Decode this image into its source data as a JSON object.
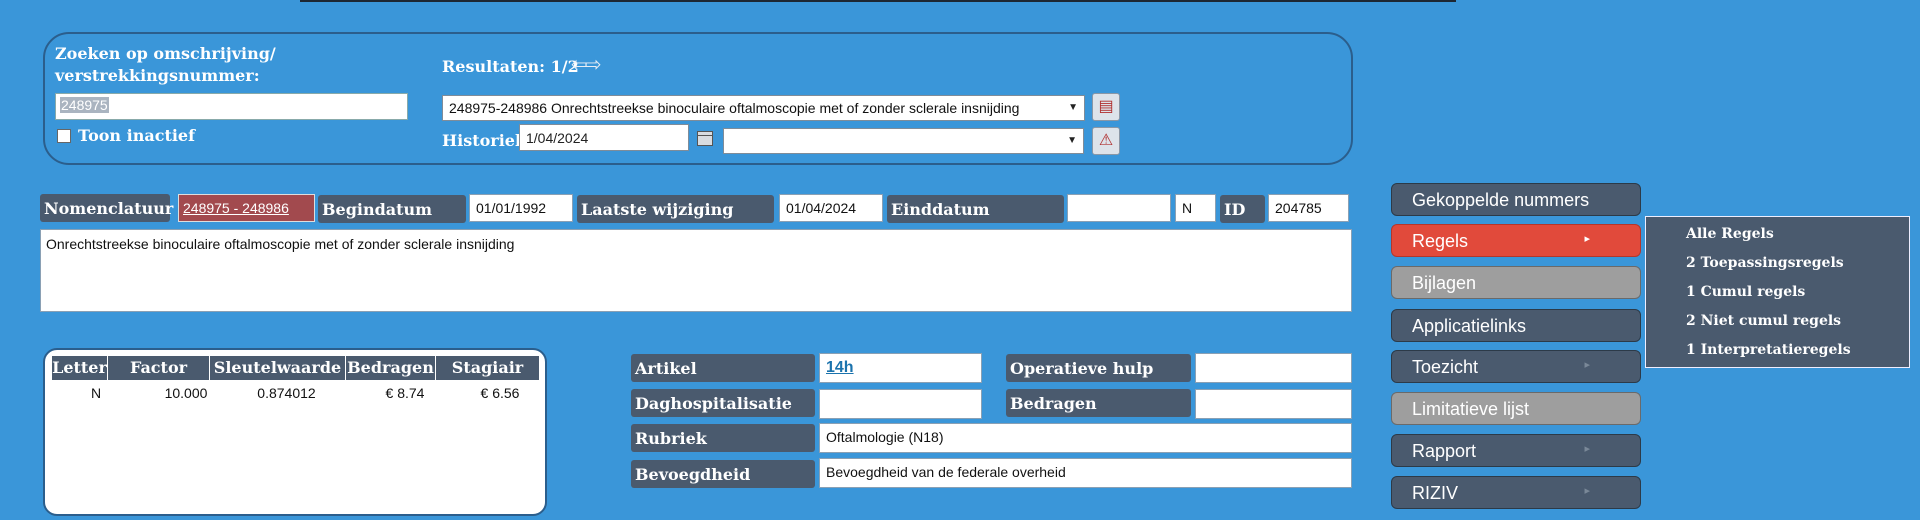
{
  "search": {
    "label": "Zoeken op omschrijving/ verstrekkingsnummer:",
    "value": "248975",
    "show_inactive_label": "Toon inactief",
    "results_label": "Resultaten: 1/2",
    "results_arrows": "⇦⇨",
    "selected_result": "248975-248986 Onrechtstreekse binoculaire oftalmoscopie met of zonder sclerale insnijding",
    "history_label": "Historiek",
    "history_date": "1/04/2024",
    "history_select": ""
  },
  "header": {
    "nomenclatuur_label": "Nomenclatuur",
    "nomenclatuur_value": "248975 - 248986",
    "begindatum_label": "Begindatum",
    "begindatum_value": "01/01/1992",
    "laatste_wijziging_label": "Laatste wijziging",
    "laatste_wijziging_value": "01/04/2024",
    "einddatum_label": "Einddatum",
    "einddatum_value": "",
    "flag_value": "N",
    "id_label": "ID",
    "id_value": "204785"
  },
  "description": "Onrechtstreekse binoculaire oftalmoscopie met of zonder sclerale insnijding",
  "table": {
    "columns": [
      "Letter",
      "Factor",
      "Sleutelwaarde",
      "Bedragen",
      "Stagiair"
    ],
    "rows": [
      [
        "N",
        "10.000",
        "0.874012",
        "€ 8.74",
        "€ 6.56"
      ]
    ]
  },
  "details": {
    "artikel_label": "Artikel",
    "artikel_value": "14h",
    "operatieve_hulp_label": "Operatieve hulp",
    "operatieve_hulp_value": "",
    "daghospitalisatie_label": "Daghospitalisatie",
    "daghospitalisatie_value": "",
    "bedragen_label": "Bedragen",
    "bedragen_value": "",
    "rubriek_label": "Rubriek",
    "rubriek_value": "Oftalmologie (N18)",
    "bevoegdheid_label": "Bevoegdheid",
    "bevoegdheid_value": "Bevoegdheid van de federale overheid"
  },
  "side_buttons": [
    {
      "label": "Gekoppelde nummers"
    },
    {
      "label": "Regels",
      "submenu_marker": "▸"
    },
    {
      "label": "Bijlagen"
    },
    {
      "label": "Applicatielinks"
    },
    {
      "label": "Toezicht",
      "submenu_marker": "▸"
    },
    {
      "label": "Limitatieve lijst"
    },
    {
      "label": "Rapport",
      "submenu_marker": "▸"
    },
    {
      "label": "RIZIV",
      "submenu_marker": "▸"
    }
  ],
  "regels_menu": [
    "Alle Regels",
    "2 Toepassingsregels",
    "1 Cumul regels",
    "2 Niet cumul regels",
    "1 Interpretatieregels"
  ],
  "icons": {
    "dropdown": "chevron-down-icon",
    "calendar": "calendar-icon",
    "nav": "arrows-icon"
  },
  "colors": {
    "background": "#3a96d9",
    "label_bg": "#4a5a6e",
    "active_button": "#e14a3b",
    "nomenclature_bg": "#a24a4e",
    "link": "#1b73ad"
  }
}
